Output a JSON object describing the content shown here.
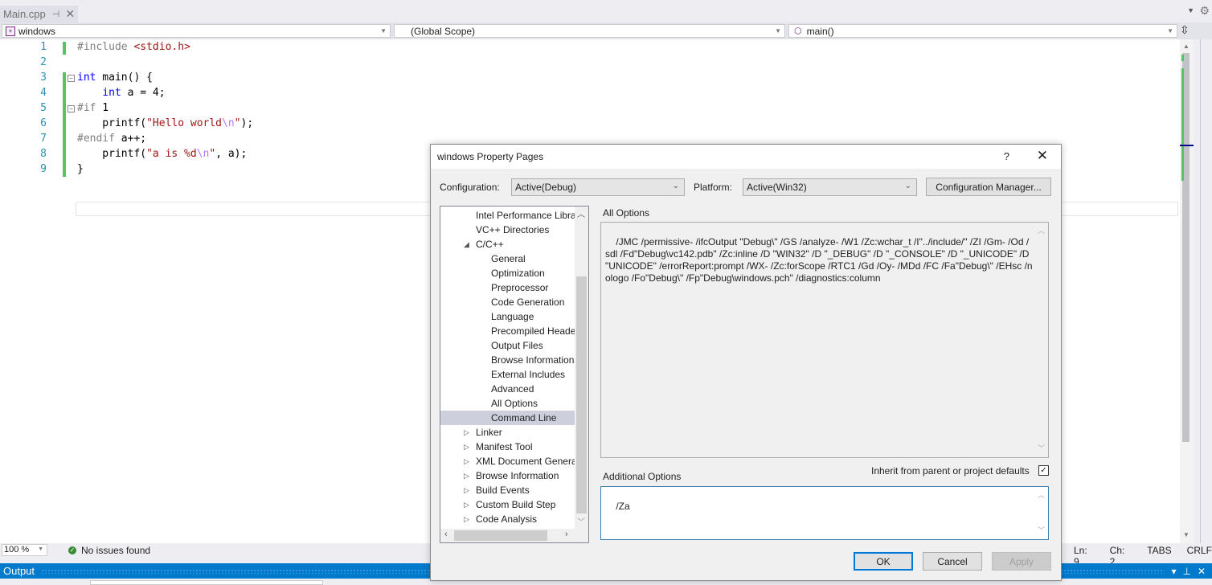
{
  "tab": {
    "title": "Main.cpp",
    "pin_icon": "pin-icon",
    "close_icon": "close-icon"
  },
  "navbar": {
    "project": "windows",
    "scope": "(Global Scope)",
    "member": "main()"
  },
  "editor": {
    "line_numbers": [
      "1",
      "2",
      "3",
      "4",
      "5",
      "6",
      "7",
      "8",
      "9"
    ]
  },
  "status": {
    "zoom": "100 %",
    "issues": "No issues found",
    "line": "Ln: 9",
    "col": "Ch: 2",
    "indent": "TABS",
    "eol": "CRLF"
  },
  "output_panel": {
    "title": "Output"
  },
  "dialog": {
    "title": "windows Property Pages",
    "help": "?",
    "config_label": "Configuration:",
    "config_value": "Active(Debug)",
    "platform_label": "Platform:",
    "platform_value": "Active(Win32)",
    "config_manager": "Configuration Manager...",
    "tree": [
      {
        "label": "Intel Performance Libra"
      },
      {
        "label": "VC++ Directories"
      },
      {
        "label": "C/C++",
        "expanded": true
      },
      {
        "label": "General"
      },
      {
        "label": "Optimization"
      },
      {
        "label": "Preprocessor"
      },
      {
        "label": "Code Generation"
      },
      {
        "label": "Language"
      },
      {
        "label": "Precompiled Heade"
      },
      {
        "label": "Output Files"
      },
      {
        "label": "Browse Information"
      },
      {
        "label": "External Includes"
      },
      {
        "label": "Advanced"
      },
      {
        "label": "All Options"
      },
      {
        "label": "Command Line",
        "selected": true
      },
      {
        "label": "Linker"
      },
      {
        "label": "Manifest Tool"
      },
      {
        "label": "XML Document Genera"
      },
      {
        "label": "Browse Information"
      },
      {
        "label": "Build Events"
      },
      {
        "label": "Custom Build Step"
      },
      {
        "label": "Code Analysis"
      }
    ],
    "all_options_label": "All Options",
    "all_options_value": "/JMC /permissive- /ifcOutput \"Debug\\\" /GS /analyze- /W1 /Zc:wchar_t /I\"../include/\" /ZI /Gm- /Od /sdl /Fd\"Debug\\vc142.pdb\" /Zc:inline /D \"WIN32\" /D \"_DEBUG\" /D \"_CONSOLE\" /D \"_UNICODE\" /D \"UNICODE\" /errorReport:prompt /WX- /Zc:forScope /RTC1 /Gd /Oy- /MDd /FC /Fa\"Debug\\\" /EHsc /nologo /Fo\"Debug\\\" /Fp\"Debug\\windows.pch\" /diagnostics:column",
    "additional_options_label": "Additional Options",
    "additional_options_value": "/Za",
    "inherit_label": "Inherit from parent or project defaults",
    "inherit_checked": true,
    "ok": "OK",
    "cancel": "Cancel",
    "apply": "Apply"
  }
}
